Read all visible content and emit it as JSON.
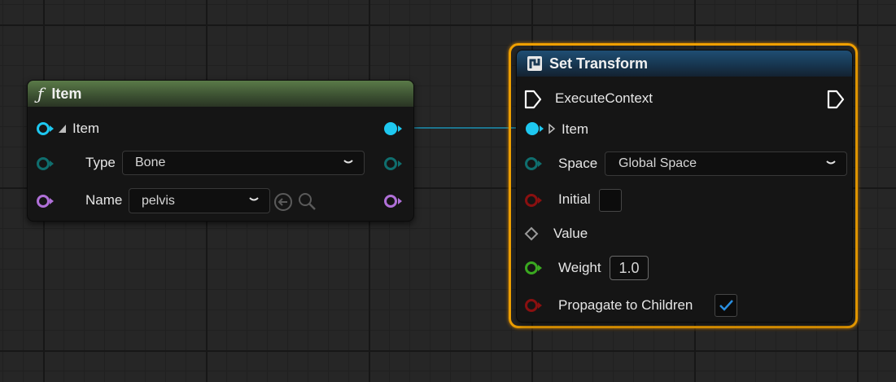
{
  "item_node": {
    "title": "Item",
    "title_icon": "ƒ",
    "rows": {
      "item_label": "Item",
      "type_label": "Type",
      "type_value": "Bone",
      "name_label": "Name",
      "name_value": "pelvis"
    },
    "header_color": "#4a6a3c"
  },
  "set_transform_node": {
    "title": "Set Transform",
    "rows": {
      "execute_label": "ExecuteContext",
      "item_label": "Item",
      "space_label": "Space",
      "space_value": "Global Space",
      "initial_label": "Initial",
      "value_label": "Value",
      "weight_label": "Weight",
      "weight_value": "1.0",
      "propagate_label": "Propagate to Children"
    },
    "initial_checked": false,
    "propagate_checked": true,
    "header_color": "#1f4e73",
    "selection_color": "#f0a000"
  },
  "colors": {
    "struct_pin": "#1ec8f0",
    "enum_pin": "#0f6e6e",
    "name_pin": "#b070d8",
    "bool_pin": "#8a1010",
    "float_pin": "#3aa820",
    "wire": "#1aa0c0"
  }
}
